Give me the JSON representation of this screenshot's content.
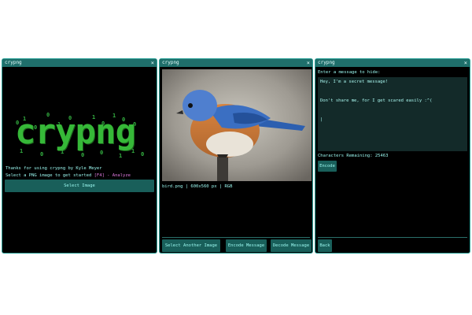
{
  "window_title": "crypng",
  "close_glyph": "×",
  "intro": {
    "thanks": "Thanks for using crypng by Kyle Meyer",
    "prompt": "Select a PNG image to get started",
    "hint": "[F4] - Analyze",
    "select_button": "Select Image",
    "logo_text": "crypng",
    "logo_bits": [
      "0",
      "1",
      "0",
      "0",
      "1",
      "0",
      "1",
      "1",
      "0",
      "1",
      "0",
      "0",
      "1",
      "0",
      "1",
      "0",
      "0",
      "1",
      "1",
      "0"
    ]
  },
  "preview": {
    "image_info": "bird.png | 600x560 px | RGB",
    "buttons": [
      "Select Another Image",
      "Encode Message",
      "Decode Message"
    ]
  },
  "encode": {
    "label": "Enter a message to hide:",
    "message": "Hey, I'm a secret message!\n\nDon't share me, for I get scared easily :^(\n\n|",
    "remaining": "Characters Remaining: 25463",
    "encode_button": "Encode",
    "back_button": "Back"
  },
  "colors": {
    "accent": "#2fa39a",
    "titlebar": "#1f6f6b",
    "button": "#195f5a",
    "logo": "#36b838",
    "hint": "#e07be0"
  }
}
